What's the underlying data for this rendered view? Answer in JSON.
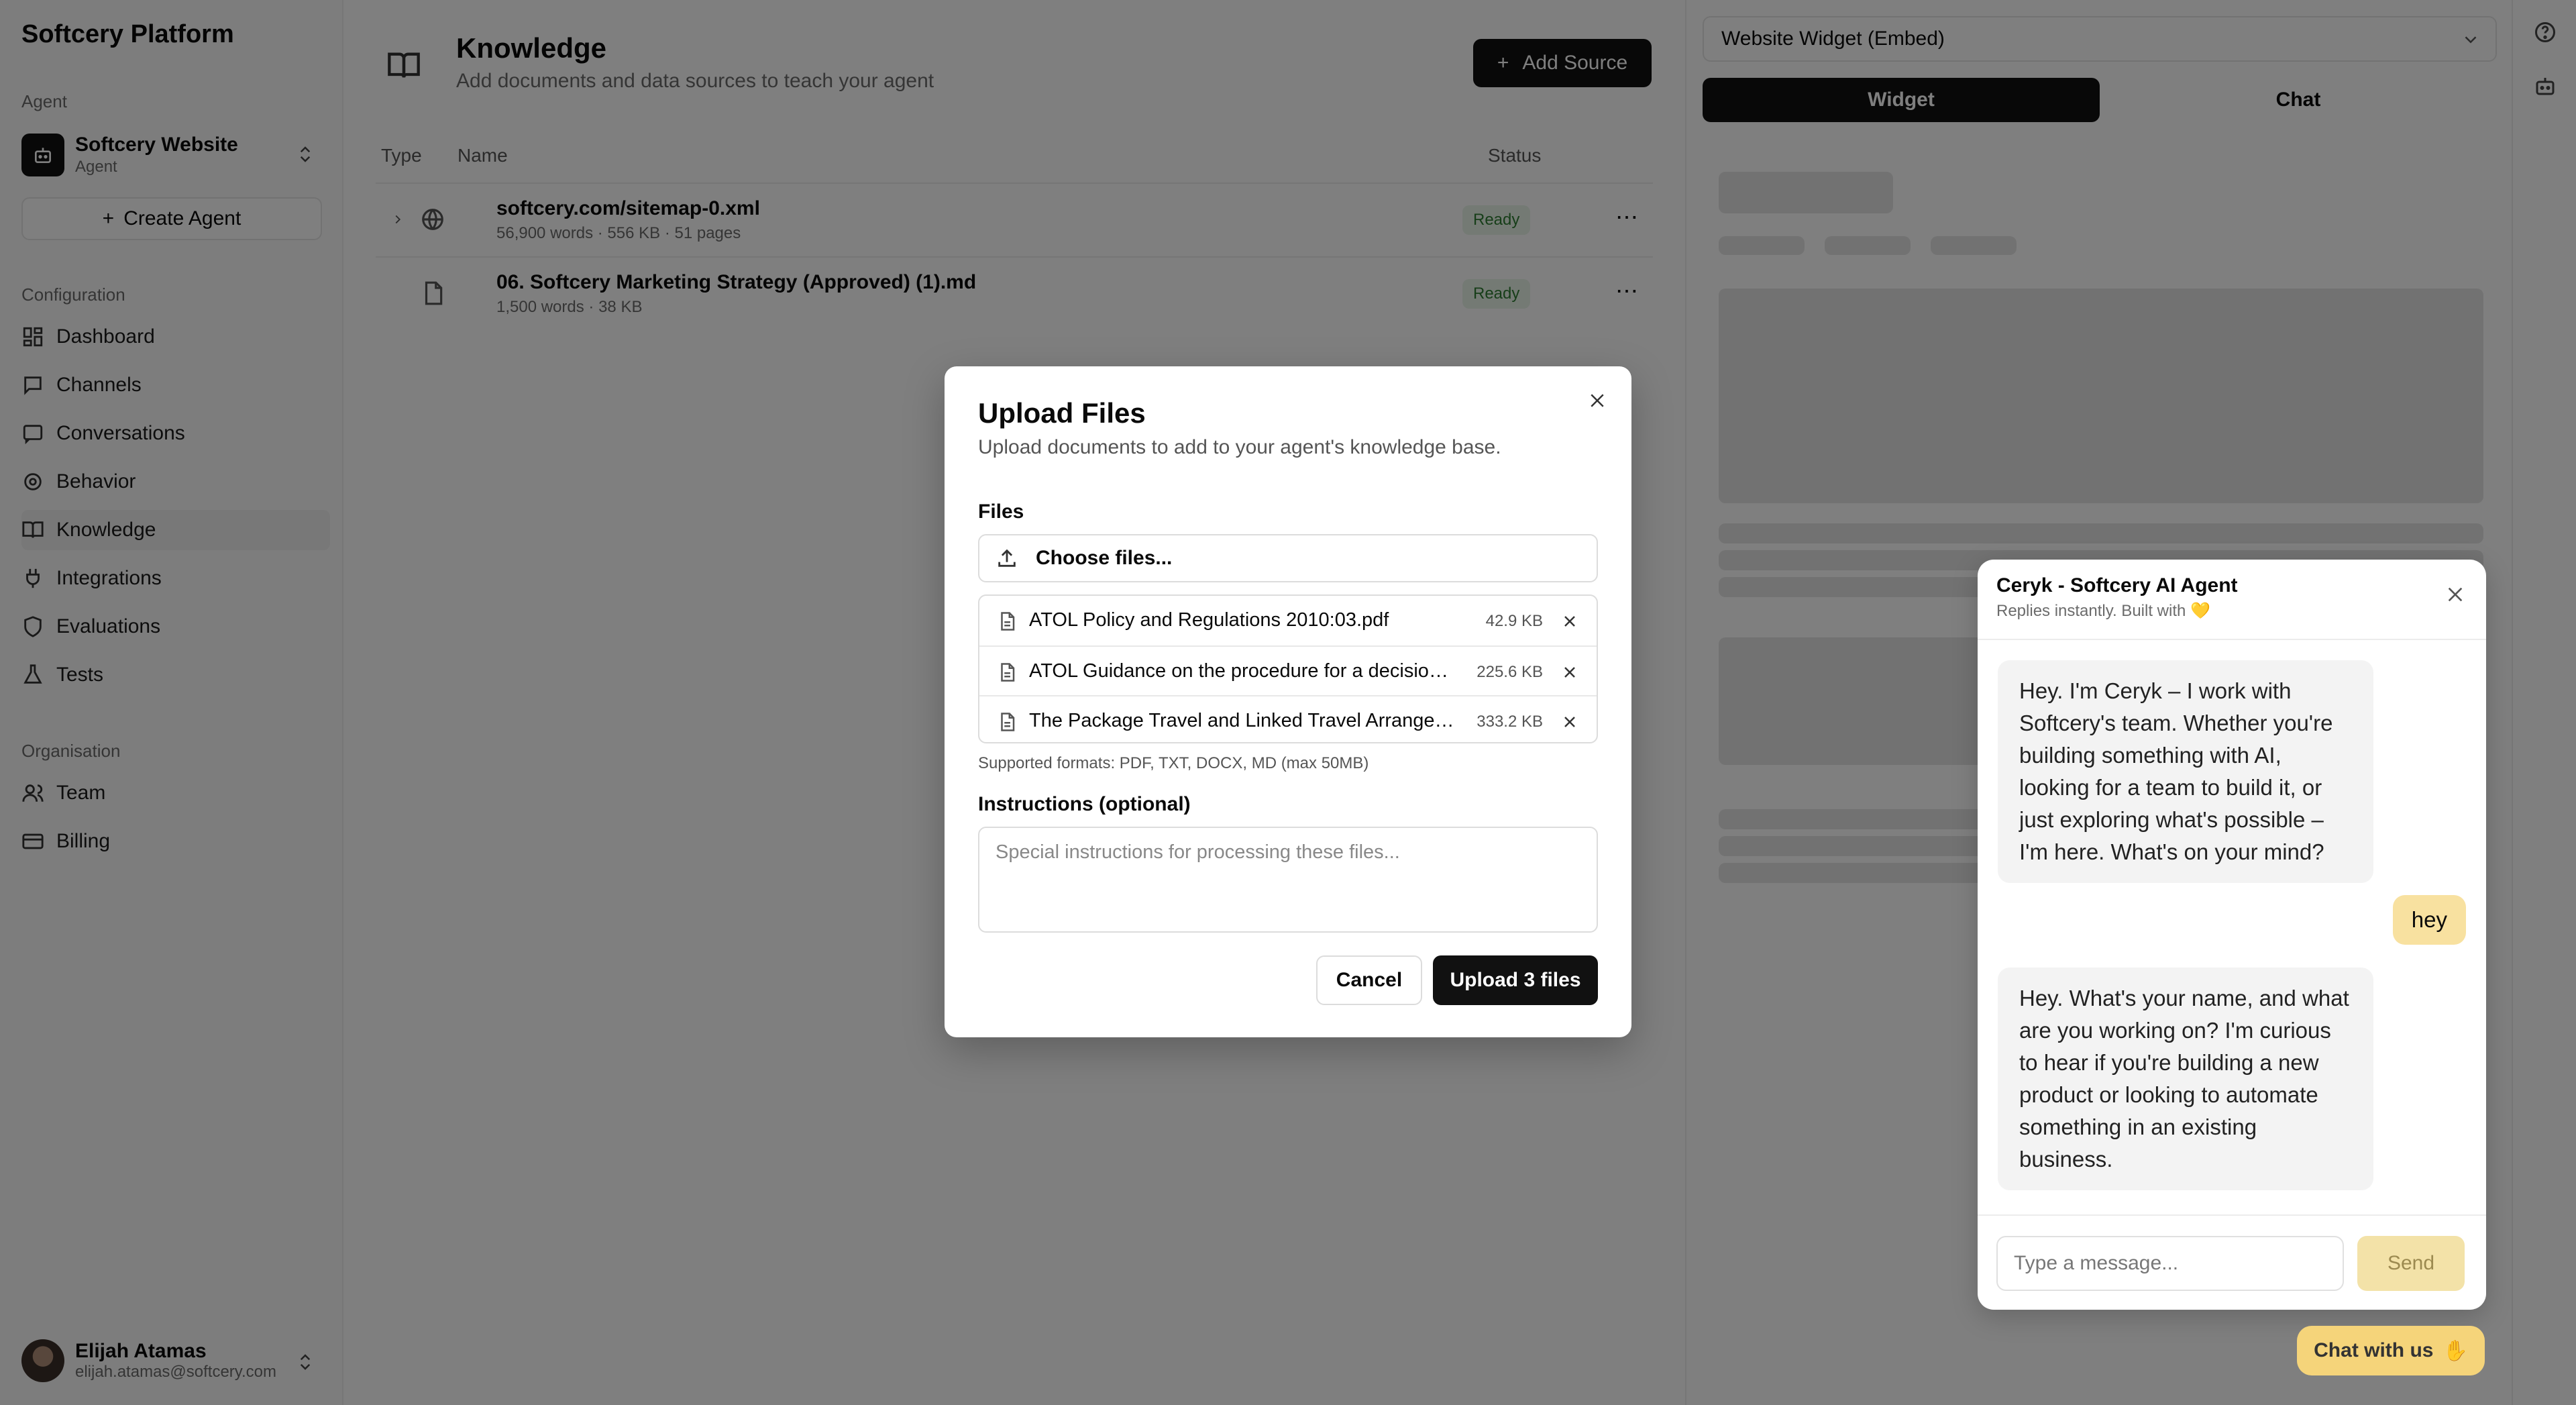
{
  "sidebar": {
    "brand": "Softcery Platform",
    "agent_section_label": "Agent",
    "agent_name": "Softcery Website",
    "agent_role": "Agent",
    "create_agent_label": "Create Agent",
    "config_label": "Configuration",
    "items": [
      {
        "label": "Dashboard",
        "icon": "dashboard-icon"
      },
      {
        "label": "Channels",
        "icon": "channels-icon"
      },
      {
        "label": "Conversations",
        "icon": "conversations-icon"
      },
      {
        "label": "Behavior",
        "icon": "behavior-icon"
      },
      {
        "label": "Knowledge",
        "icon": "knowledge-icon"
      },
      {
        "label": "Integrations",
        "icon": "integrations-icon"
      },
      {
        "label": "Evaluations",
        "icon": "evaluations-icon"
      },
      {
        "label": "Tests",
        "icon": "tests-icon"
      }
    ],
    "org_label": "Organisation",
    "org_items": [
      {
        "label": "Team",
        "icon": "team-icon"
      },
      {
        "label": "Billing",
        "icon": "billing-icon"
      }
    ],
    "user": {
      "name": "Elijah Atamas",
      "email": "elijah.atamas@softcery.com"
    }
  },
  "knowledge": {
    "title": "Knowledge",
    "subtitle": "Add documents and data sources to teach your agent",
    "add_source_label": "Add Source",
    "columns": {
      "type": "Type",
      "name": "Name",
      "status": "Status"
    },
    "rows": [
      {
        "name": "softcery.com/sitemap-0.xml",
        "meta": "56,900 words · 556 KB · 51 pages",
        "status": "Ready",
        "icon": "globe-icon"
      },
      {
        "name": "06. Softcery Marketing Strategy (Approved) (1).md",
        "meta": "1,500 words · 38 KB",
        "status": "Ready",
        "icon": "file-icon"
      }
    ]
  },
  "preview": {
    "embed_select": "Website Widget (Embed)",
    "tabs": [
      "Widget",
      "Chat"
    ]
  },
  "chat": {
    "title": "Ceryk - Softcery AI Agent",
    "subtitle": "Replies instantly. Built with 💛",
    "messages": [
      {
        "from": "bot",
        "text": "Hey. I'm Ceryk – I work with Softcery's team. Whether you're building something with AI, looking for a team to build it, or just exploring what's possible – I'm here. What's on your mind?"
      },
      {
        "from": "user",
        "text": "hey"
      },
      {
        "from": "bot",
        "text": "Hey. What's your name, and what are you working on? I'm curious to hear if you're building a new product or looking to automate something in an existing business."
      }
    ],
    "input_placeholder": "Type a message...",
    "send_label": "Send",
    "fab_label": "Chat with us"
  },
  "modal": {
    "title": "Upload Files",
    "subtitle": "Upload documents to add to your agent's knowledge base.",
    "files_label": "Files",
    "choose_label": "Choose files...",
    "files": [
      {
        "name": "ATOL Policy and Regulations 2010:03.pdf",
        "size": "42.9 KB"
      },
      {
        "name": "ATOL Guidance on the procedure for a decision on ATOL holder",
        "size": "225.6 KB"
      },
      {
        "name": "The Package Travel and Linked Travel Arrangements Regulations",
        "size": "333.2 KB"
      }
    ],
    "supported": "Supported formats: PDF, TXT, DOCX, MD (max 50MB)",
    "instructions_label": "Instructions (optional)",
    "instructions_placeholder": "Special instructions for processing these files...",
    "cancel_label": "Cancel",
    "upload_label": "Upload 3 files"
  }
}
